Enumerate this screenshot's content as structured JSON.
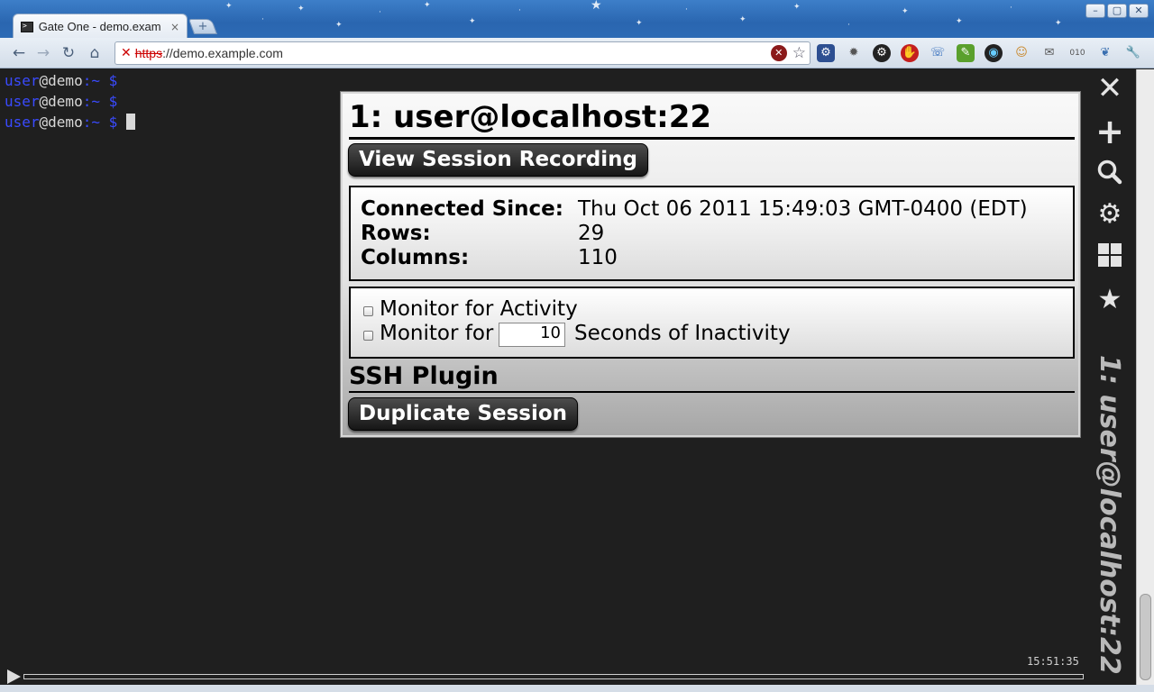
{
  "browser": {
    "tab_title": "Gate One - demo.exam",
    "tab_close": "×",
    "newtab_label": "+",
    "url_scheme": "https",
    "url_separator": "://",
    "url_host": "demo.example.com",
    "window_buttons": [
      "–",
      "▢",
      "✕"
    ]
  },
  "terminal": {
    "lines": [
      {
        "user": "user",
        "host": "@demo",
        "path": ":~ $"
      },
      {
        "user": "user",
        "host": "@demo",
        "path": ":~ $"
      },
      {
        "user": "user",
        "host": "@demo",
        "path": ":~ $ "
      }
    ],
    "clock": "15:51:35"
  },
  "sidebar": {
    "icons": [
      "close-icon",
      "plus-icon",
      "search-icon",
      "gear-icon",
      "grid-icon",
      "star-icon"
    ],
    "vertical_title": "1: user@localhost:22"
  },
  "panel": {
    "title": "1: user@localhost:22",
    "view_recording_label": "View Session Recording",
    "info": {
      "connected_label": "Connected Since:",
      "connected_value": "Thu Oct 06 2011 15:49:03 GMT-0400 (EDT)",
      "rows_label": "Rows:",
      "rows_value": "29",
      "columns_label": "Columns:",
      "columns_value": "110"
    },
    "monitor": {
      "activity_label": "Monitor for Activity",
      "inactivity_prefix": "Monitor for",
      "inactivity_seconds": "10",
      "inactivity_suffix": "Seconds of Inactivity"
    },
    "ssh_heading": "SSH Plugin",
    "duplicate_label": "Duplicate Session"
  }
}
